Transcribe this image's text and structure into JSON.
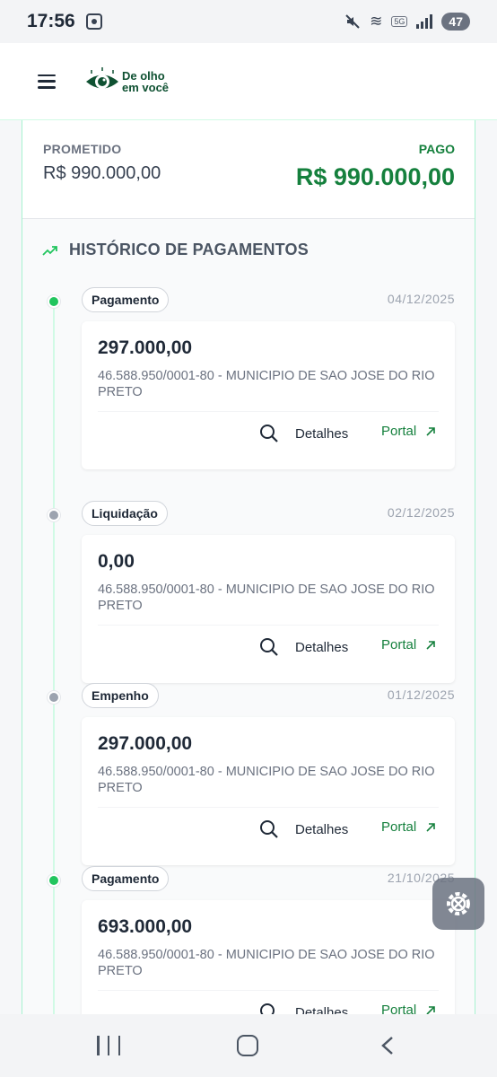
{
  "status_bar": {
    "time": "17:56",
    "battery": "47",
    "network": "5G"
  },
  "header": {
    "logo_line1": "De olho",
    "logo_line2": "em você"
  },
  "summary": {
    "promised_label": "PROMETIDO",
    "promised_value": "R$ 990.000,00",
    "paid_label": "PAGO",
    "paid_value": "R$ 990.000,00"
  },
  "history": {
    "title": "HISTÓRICO DE PAGAMENTOS",
    "details_label": "Detalhes",
    "portal_label": "Portal",
    "entries": [
      {
        "type": "Pagamento",
        "date": "04/12/2025",
        "amount": "297.000,00",
        "description": "46.588.950/0001-80 - MUNICIPIO DE SAO JOSE DO RIO PRETO",
        "dot": "green"
      },
      {
        "type": "Liquidação",
        "date": "02/12/2025",
        "amount": "0,00",
        "description": "46.588.950/0001-80 - MUNICIPIO DE SAO JOSE DO RIO PRETO",
        "dot": "gray"
      },
      {
        "type": "Empenho",
        "date": "01/12/2025",
        "amount": "297.000,00",
        "description": "46.588.950/0001-80 - MUNICIPIO DE SAO JOSE DO RIO PRETO",
        "dot": "gray"
      },
      {
        "type": "Pagamento",
        "date": "21/10/2025",
        "amount": "693.000,00",
        "description": "46.588.950/0001-80 - MUNICIPIO DE SAO JOSE DO RIO PRETO",
        "dot": "green"
      }
    ]
  },
  "colors": {
    "accent_green": "#15803d",
    "dot_green": "#22c55e",
    "dot_gray": "#9ca3af"
  }
}
